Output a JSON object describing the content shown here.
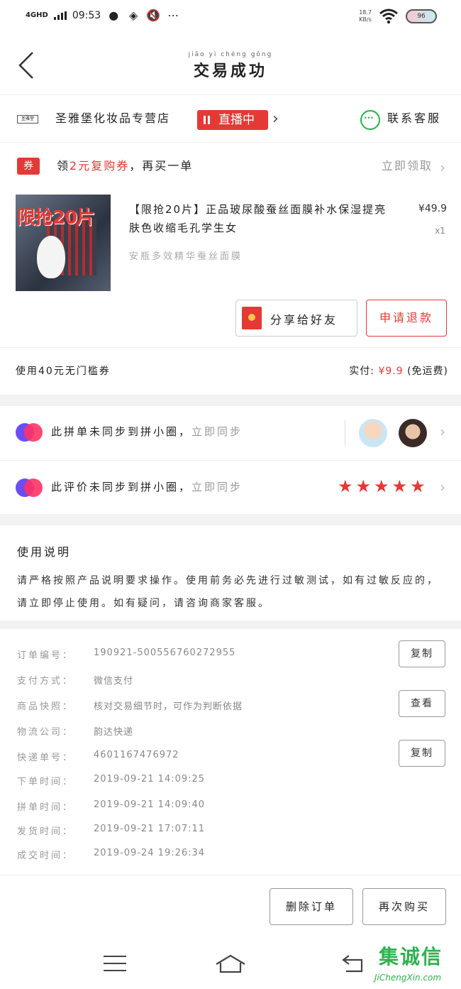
{
  "status_bar": {
    "network": "4GHD",
    "time": "09:53",
    "speed_value": "18.7",
    "speed_unit": "KB/s",
    "battery": "96"
  },
  "header": {
    "title_pinyin": "jiāo yì chéng gōng",
    "title": "交易成功"
  },
  "store": {
    "logo_text": "圣雅堂",
    "name": "圣雅堡化妆品专营店",
    "live_label": "直播中",
    "cs_label": "联系客服"
  },
  "coupon": {
    "icon_label": "券",
    "text_prefix": "领",
    "text_red": "2元复购券",
    "text_suffix": "，再买一单",
    "claim_label": "立即领取"
  },
  "product": {
    "promo_overlay": "限抢20片",
    "title": "【限抢20片】正品玻尿酸蚕丝面膜补水保湿提亮肤色收缩毛孔学生女",
    "price": "¥49.9",
    "qty": "x1",
    "spec": "安瓶多效精华蚕丝面膜"
  },
  "buttons": {
    "share_label": "分享给好友",
    "refund_label": "申请退款"
  },
  "summary": {
    "coupon_used": "使用40元无门槛券",
    "paid_label": "实付:",
    "paid_amount": "¥9.9",
    "shipping_note": "(免运费)"
  },
  "sync_rows": {
    "row1_text": "此拼单未同步到拼小圈，",
    "row1_action": "立即同步",
    "row2_text": "此评价未同步到拼小圈，",
    "row2_action": "立即同步",
    "stars": 5
  },
  "instructions": {
    "title": "使用说明",
    "body": "请严格按照产品说明要求操作。使用前务必先进行过敏测试，如有过敏反应的，请立即停止使用。如有疑问，请咨询商家客服。"
  },
  "order_details": {
    "rows": [
      {
        "label": "订单编号：",
        "value": "190921-500556760272955"
      },
      {
        "label": "支付方式：",
        "value": "微信支付"
      },
      {
        "label": "商品快照：",
        "value": "核对交易细节时，可作为判断依据"
      },
      {
        "label": "物流公司：",
        "value": "韵达快递"
      },
      {
        "label": "快递单号：",
        "value": "4601167476972"
      },
      {
        "label": "下单时间：",
        "value": "2019-09-21 14:09:25"
      },
      {
        "label": "拼单时间：",
        "value": "2019-09-21 14:09:40"
      },
      {
        "label": "发货时间：",
        "value": "2019-09-21 17:07:11"
      },
      {
        "label": "成交时间：",
        "value": "2019-09-24 19:26:34"
      }
    ],
    "copy_label": "复制",
    "view_label": "查看"
  },
  "actions": {
    "delete_label": "删除订单",
    "rebuy_label": "再次购买"
  },
  "watermark": {
    "chars": "集诚信",
    "url": "JiChengXin.com"
  },
  "colors": {
    "accent_red": "#e53935",
    "wechat_green": "#2ab04a",
    "muted_gray": "#999999"
  }
}
